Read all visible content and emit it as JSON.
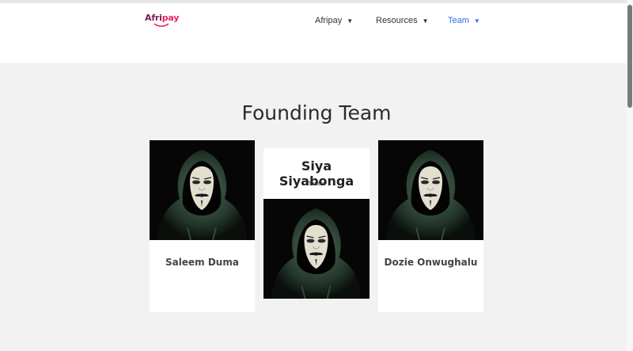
{
  "header": {
    "logo": {
      "part1": "Afri",
      "part2": "pay"
    },
    "nav": [
      {
        "label": "Afripay",
        "caret": "▼"
      },
      {
        "label": "Resources",
        "caret": "▼"
      },
      {
        "label": "Team",
        "caret": "▼"
      }
    ]
  },
  "section": {
    "title": "Founding Team"
  },
  "members": [
    {
      "name": "Saleem Duma"
    },
    {
      "name": "Siya Siyabonga",
      "social": "Twitter"
    },
    {
      "name": "Dozie Onwughalu"
    }
  ],
  "colors": {
    "accent": "#2d6df6",
    "logo_dark": "#7a1d52",
    "logo_pink": "#e8225b",
    "background": "#f2f2f2"
  }
}
